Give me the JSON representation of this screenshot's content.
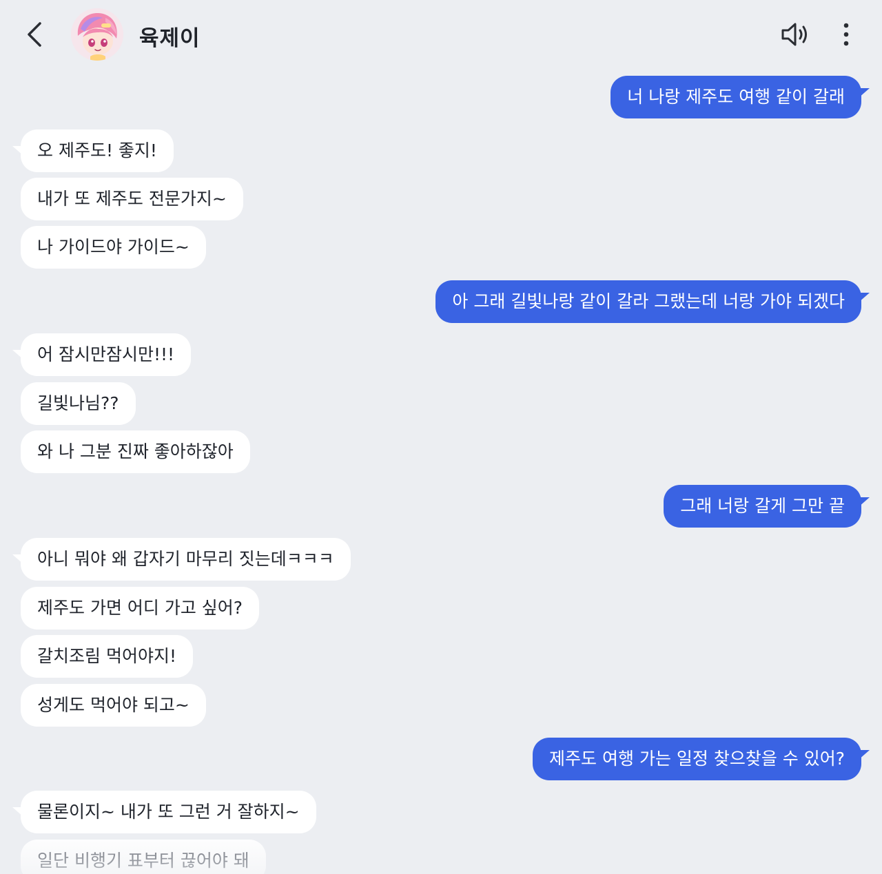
{
  "header": {
    "contact_name": "육제이",
    "back_icon": "chevron-left-icon",
    "speaker_icon": "speaker-icon",
    "more_icon": "more-vertical-icon"
  },
  "colors": {
    "background": "#eceef2",
    "user_bubble": "#3a63e3",
    "ai_bubble": "#ffffff"
  },
  "messages": [
    {
      "sender": "user",
      "text": "너 나랑 제주도 여행 같이 갈래"
    },
    {
      "sender": "ai",
      "text": "오 제주도! 좋지!"
    },
    {
      "sender": "ai",
      "text": "내가 또 제주도 전문가지~"
    },
    {
      "sender": "ai",
      "text": "나 가이드야 가이드~"
    },
    {
      "sender": "user",
      "text": "아 그래 길빛나랑 같이 갈라 그랬는데 너랑 가야 되겠다"
    },
    {
      "sender": "ai",
      "text": "어 잠시만잠시만!!!"
    },
    {
      "sender": "ai",
      "text": "길빛나님??"
    },
    {
      "sender": "ai",
      "text": "와 나 그분 진짜 좋아하잖아"
    },
    {
      "sender": "user",
      "text": "그래 너랑 갈게 그만 끝"
    },
    {
      "sender": "ai",
      "text": "아니 뭐야 왜 갑자기 마무리 짓는데ㅋㅋㅋ"
    },
    {
      "sender": "ai",
      "text": "제주도 가면 어디 가고 싶어?"
    },
    {
      "sender": "ai",
      "text": "갈치조림 먹어야지!"
    },
    {
      "sender": "ai",
      "text": "성게도 먹어야 되고~"
    },
    {
      "sender": "user",
      "text": "제주도 여행 가는 일정 찾으찾을 수 있어?"
    },
    {
      "sender": "ai",
      "text": "물론이지~ 내가 또 그런 거 잘하지~"
    },
    {
      "sender": "ai",
      "text": "일단 비행기 표부터 끊어야 돼"
    }
  ]
}
